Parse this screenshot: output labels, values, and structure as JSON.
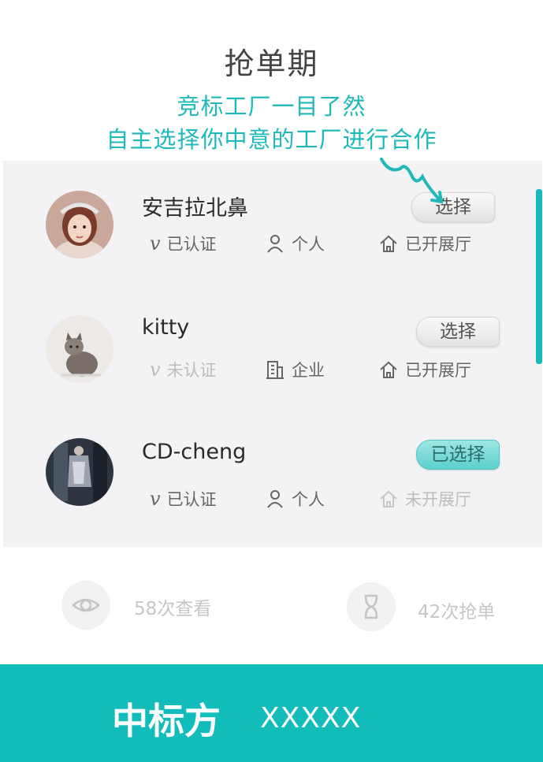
{
  "header": {
    "title": "抢单期",
    "tagline_1": "竞标工厂一目了然",
    "tagline_2": "自主选择你中意的工厂进行合作"
  },
  "factories": [
    {
      "name": "安吉拉北鼻",
      "cert": "已认证",
      "type": "个人",
      "showroom": "已开展厅",
      "button": "选择",
      "selected": false,
      "certified": true,
      "has_showroom": true
    },
    {
      "name": "kitty",
      "cert": "未认证",
      "type": "企业",
      "showroom": "已开展厅",
      "button": "选择",
      "selected": false,
      "certified": false,
      "has_showroom": true
    },
    {
      "name": "CD-cheng",
      "cert": "已认证",
      "type": "个人",
      "showroom": "未开展厅",
      "button": "已选择",
      "selected": true,
      "certified": true,
      "has_showroom": false
    }
  ],
  "stats": {
    "views": "58次查看",
    "grabs": "42次抢单"
  },
  "footer": {
    "label": "中标方",
    "value": "XXXXX"
  },
  "colors": {
    "accent": "#11bcbb",
    "tagline": "#1fb9ba",
    "panel": "#f3f3f5"
  },
  "icons": {
    "cert": "v-verified-icon",
    "person": "person-icon",
    "company": "building-icon",
    "showroom": "house-icon",
    "views": "eye-icon",
    "grabs": "hourglass-icon"
  }
}
